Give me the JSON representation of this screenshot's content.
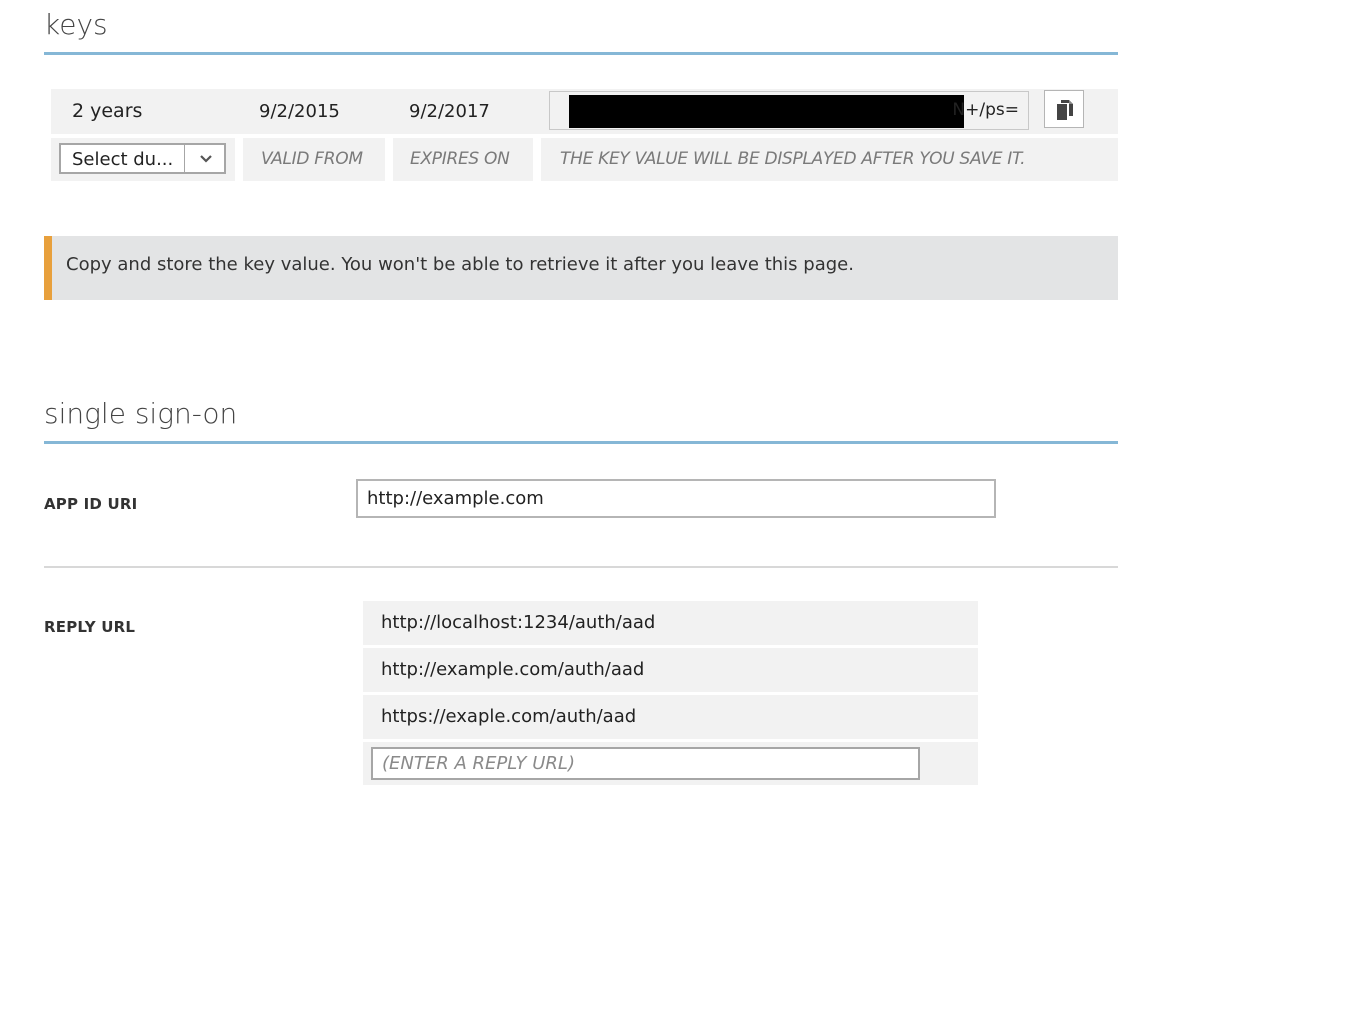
{
  "keys": {
    "title": "keys",
    "existing_key": {
      "duration": "2 years",
      "valid_from": "9/2/2015",
      "expires_on": "9/2/2017",
      "value_visible_suffix": "N+/ps=",
      "copy_icon": "copy-icon"
    },
    "new_key": {
      "duration_select_value": "Select du...",
      "valid_from_placeholder": "VALID FROM",
      "expires_on_placeholder": "EXPIRES ON",
      "value_placeholder": "THE KEY VALUE WILL BE DISPLAYED AFTER YOU SAVE IT."
    }
  },
  "notice": {
    "text": "Copy and store the key value. You won't be able to retrieve it after you leave this page.",
    "accent_color": "#e8a03c"
  },
  "sso": {
    "title": "single sign-on",
    "app_id_uri": {
      "label": "APP ID URI",
      "value": "http://example.com"
    },
    "reply_url": {
      "label": "REPLY URL",
      "items": [
        "http://localhost:1234/auth/aad",
        "http://example.com/auth/aad",
        "https://exaple.com/auth/aad"
      ],
      "new_placeholder": "(ENTER A REPLY URL)"
    }
  },
  "colors": {
    "section_rule": "#85b7d6",
    "row_background": "#f2f2f2"
  }
}
